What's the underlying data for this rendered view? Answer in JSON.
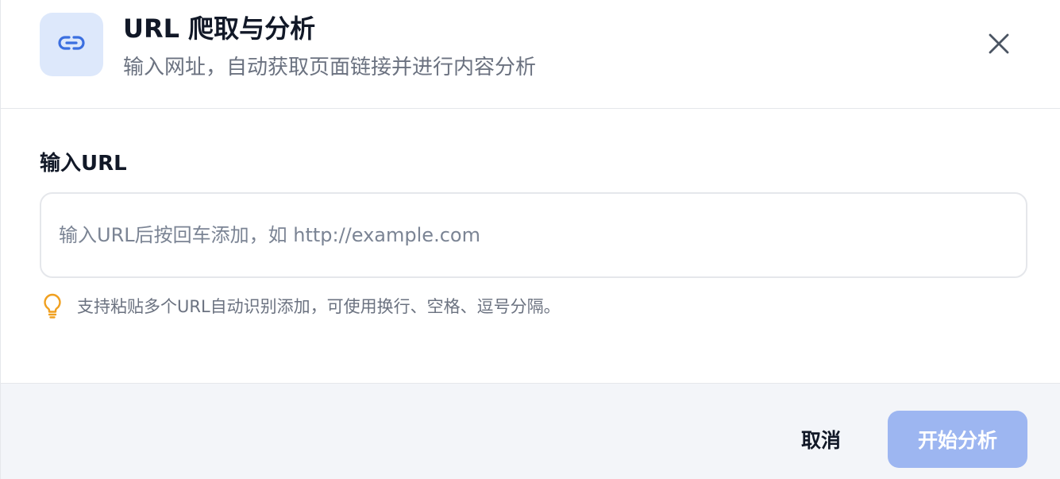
{
  "dialog": {
    "title": "URL 爬取与分析",
    "subtitle": "输入网址，自动获取页面链接并进行内容分析",
    "header_icon": "link-icon",
    "close_icon": "close-icon"
  },
  "form": {
    "url_label": "输入URL",
    "url_placeholder": "输入URL后按回车添加，如 http://example.com",
    "url_value": "",
    "hint_icon": "lightbulb-icon",
    "hint_text": "支持粘贴多个URL自动识别添加，可使用换行、空格、逗号分隔。"
  },
  "footer": {
    "cancel_label": "取消",
    "start_label": "开始分析"
  },
  "colors": {
    "accent": "#3b6fe0",
    "icon_bg": "#dde8fb",
    "start_disabled": "#9db6f1",
    "hint_icon": "#f0a020",
    "footer_bg": "#f3f5f9"
  }
}
